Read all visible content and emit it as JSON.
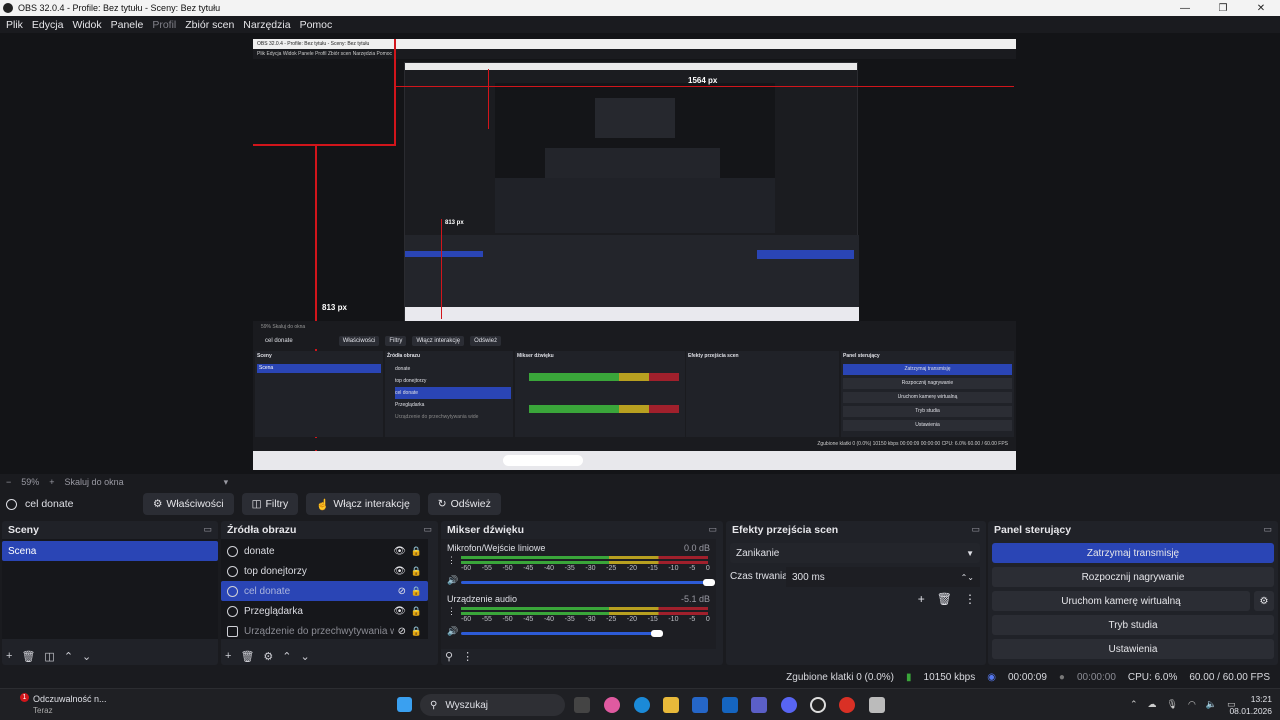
{
  "window": {
    "title": "OBS 32.0.4 - Profile: Bez tytułu - Sceny: Bez tytułu"
  },
  "menu": [
    "Plik",
    "Edycja",
    "Widok",
    "Panele",
    "Profil",
    "Zbiór scen",
    "Narzędzia",
    "Pomoc"
  ],
  "preview": {
    "inner_title": "OBS 32.0.4 - Profile: Bez tytułu - Sceny: Bez tytułu",
    "measure_top": "1564 px",
    "measure_left": "813 px",
    "measure_inner": "813 px",
    "inner_zoom": "59%",
    "inner_fit": "Skaluj do okna",
    "inner_source": "cel donate",
    "inner_buttons": [
      "Właściwości",
      "Filtry",
      "Włącz interakcję",
      "Odśwież"
    ],
    "inner_docks": [
      "Sceny",
      "Źródła obrazu",
      "Mikser dźwięku",
      "Efekty przejścia scen",
      "Panel sterujący"
    ],
    "inner_controls": [
      "Zatrzymaj transmisję",
      "Rozpocznij nagrywanie",
      "Uruchom kamerę wirtualną",
      "Tryb studia",
      "Ustawienia"
    ],
    "inner_sources": [
      "donate",
      "top donejtorzy",
      "cel donate",
      "Przeglądarka",
      "Urządzenie do przechwytywania wide"
    ],
    "inner_status": "Zgubione klatki 0 (0.0%)   10150 kbps   00:00:09   00:00:00   CPU: 6.0%   60.00 / 60.00 FPS"
  },
  "zoombar": {
    "minus": "−",
    "zoom": "59%",
    "plus": "+",
    "fit": "Skaluj do okna"
  },
  "source_toolbar": {
    "current": "cel donate",
    "properties": "Właściwości",
    "filters": "Filtry",
    "interact": "Włącz interakcję",
    "refresh": "Odśwież"
  },
  "scenes": {
    "title": "Sceny",
    "items": [
      "Scena"
    ]
  },
  "sources": {
    "title": "Źródła obrazu",
    "items": [
      {
        "label": "donate",
        "state": "normal"
      },
      {
        "label": "top donejtorzy",
        "state": "normal"
      },
      {
        "label": "cel donate",
        "state": "selected"
      },
      {
        "label": "Przeglądarka",
        "state": "normal"
      },
      {
        "label": "Urządzenie do przechwytywania wideo",
        "state": "dim"
      }
    ]
  },
  "mixer": {
    "title": "Mikser dźwięku",
    "scale": [
      "-60",
      "-55",
      "-50",
      "-45",
      "-40",
      "-35",
      "-30",
      "-25",
      "-20",
      "-15",
      "-10",
      "-5",
      "0"
    ],
    "channels": [
      {
        "name": "Mikrofon/Wejście liniowe",
        "db": "0.0 dB",
        "level": 0.95
      },
      {
        "name": "Urządzenie audio",
        "db": "-5.1 dB",
        "level": 0.78
      }
    ]
  },
  "transitions": {
    "title": "Efekty przejścia scen",
    "selected": "Zanikanie",
    "duration_label": "Czas trwania",
    "duration": "300 ms"
  },
  "controls": {
    "title": "Panel sterujący",
    "stop_stream": "Zatrzymaj transmisję",
    "start_rec": "Rozpocznij nagrywanie",
    "virtual_cam": "Uruchom kamerę wirtualną",
    "studio": "Tryb studia",
    "settings": "Ustawienia"
  },
  "status": {
    "dropped": "Zgubione klatki 0 (0.0%)",
    "bitrate": "10150 kbps",
    "stream_time": "00:00:09",
    "rec_time": "00:00:00",
    "cpu": "CPU: 6.0%",
    "fps": "60.00 / 60.00 FPS"
  },
  "taskbar": {
    "notif_title": "Odczuwalność n...",
    "notif_sub": "Teraz",
    "notif_badge": "1",
    "search": "Wyszukaj",
    "time": "13:21",
    "date": "08.01.2026"
  },
  "colors": {
    "accent": "#2a45b5",
    "measure": "#d1151b",
    "meter_green": "#3aa63a",
    "meter_yellow": "#b8a020",
    "meter_red": "#a0202c"
  }
}
